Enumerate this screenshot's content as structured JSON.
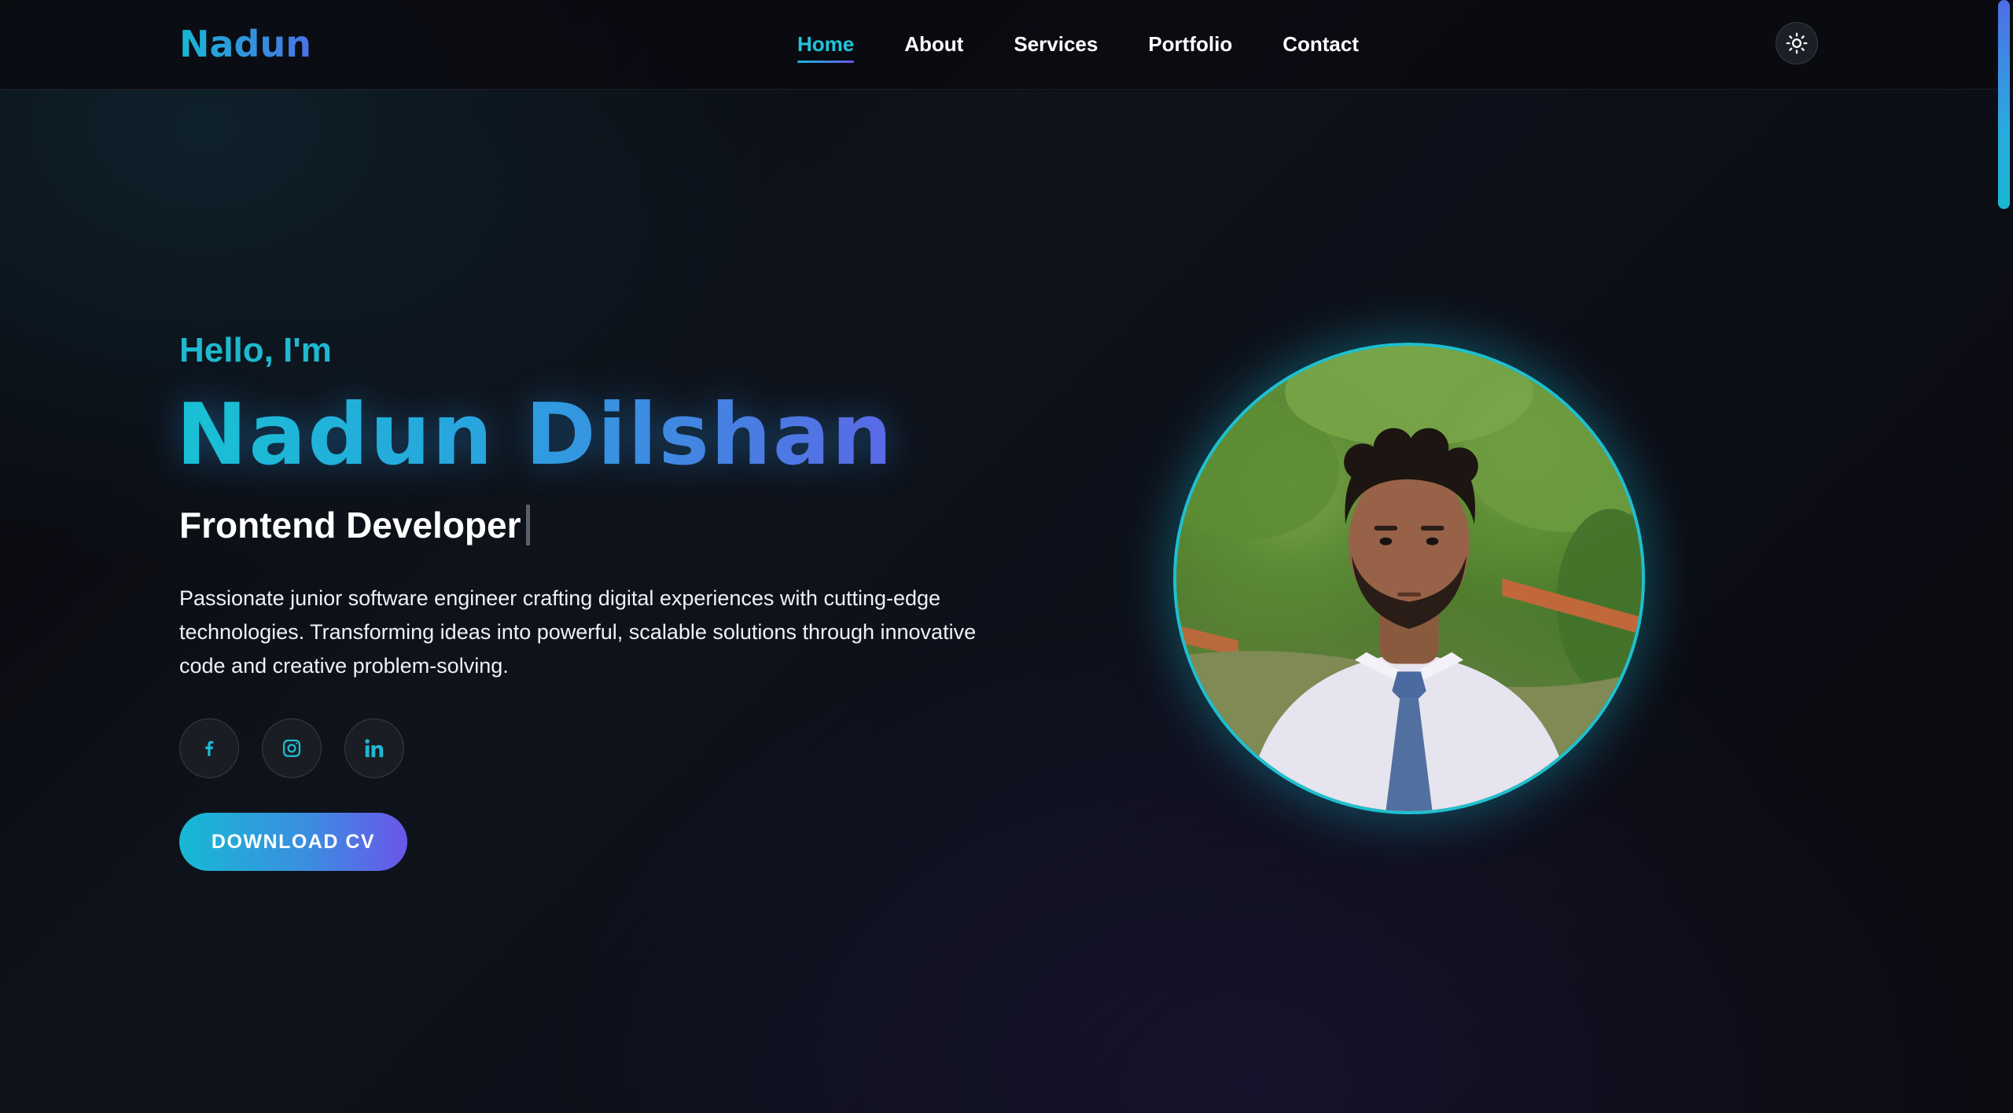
{
  "header": {
    "logo": "Nadun",
    "nav": [
      {
        "label": "Home",
        "active": true
      },
      {
        "label": "About",
        "active": false
      },
      {
        "label": "Services",
        "active": false
      },
      {
        "label": "Portfolio",
        "active": false
      },
      {
        "label": "Contact",
        "active": false
      }
    ],
    "theme_toggle_icon": "sun-icon"
  },
  "hero": {
    "greeting": "Hello, I'm",
    "name": "Nadun Dilshan",
    "role": "Frontend Developer",
    "bio": "Passionate junior software engineer crafting digital experiences with cutting-edge technologies. Transforming ideas into powerful, scalable solutions through innovative code and creative problem-solving.",
    "socials": [
      {
        "icon": "facebook-icon"
      },
      {
        "icon": "instagram-icon"
      },
      {
        "icon": "linkedin-icon"
      }
    ],
    "cv_button": "DOWNLOAD CV"
  },
  "colors": {
    "accent": "#1fb8cf",
    "accent_secondary": "#6a56ea",
    "background": "#0b0c12"
  }
}
